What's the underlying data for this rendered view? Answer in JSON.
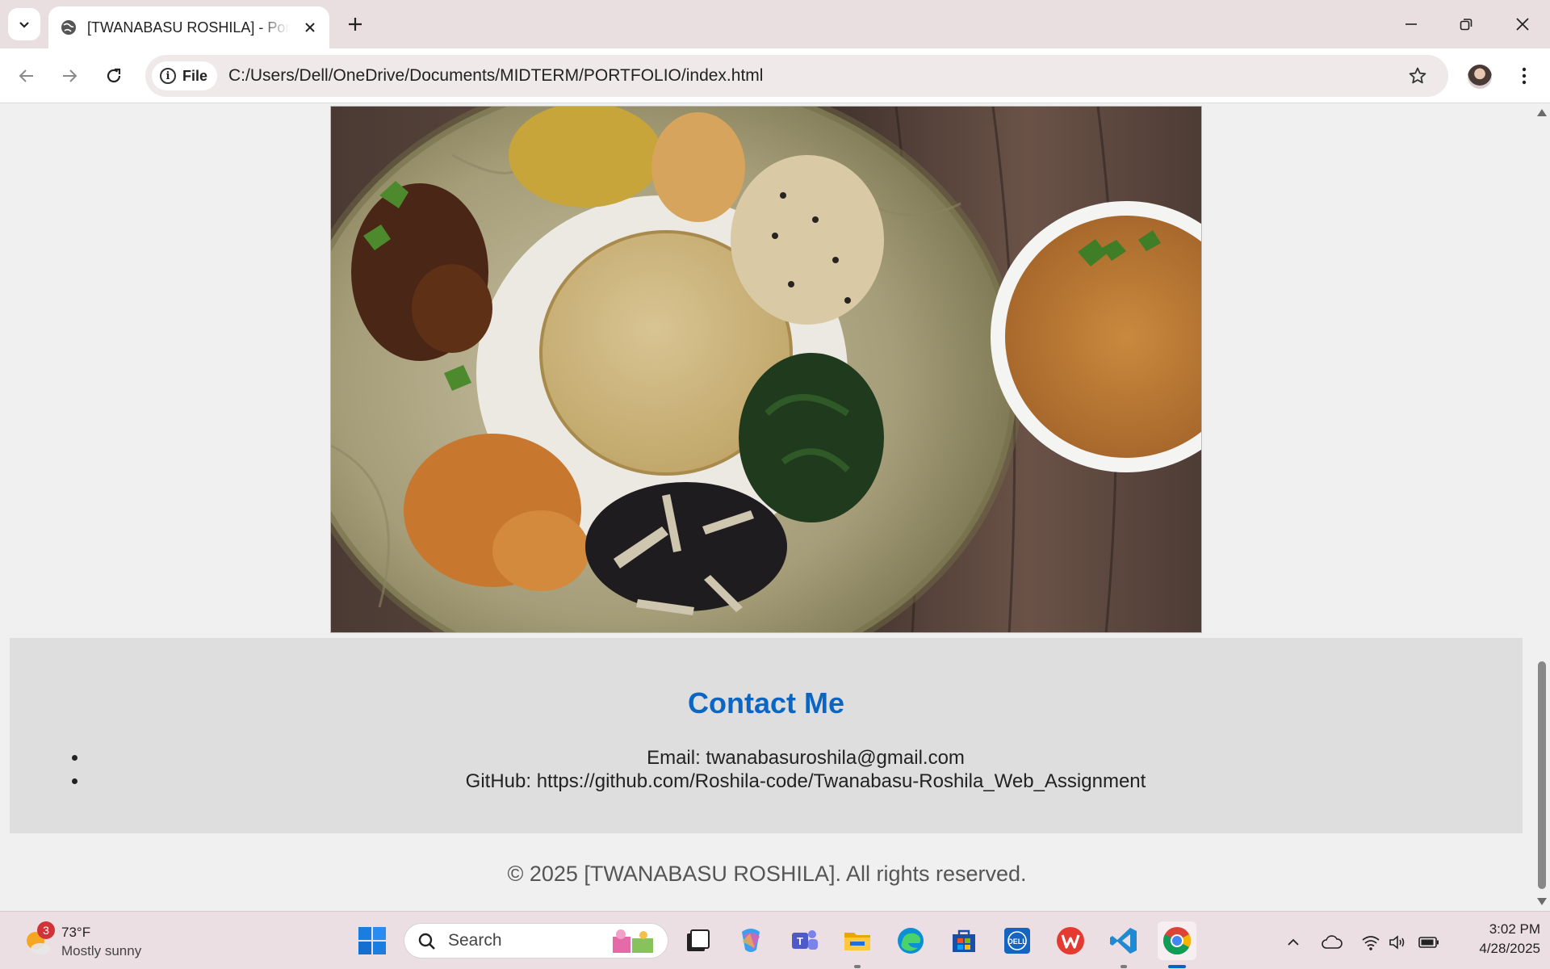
{
  "browser": {
    "tab_title": "[TWANABASU ROSHILA] - Portfolio",
    "site_chip_label": "File",
    "url": "C:/Users/Dell/OneDrive/Documents/MIDTERM/PORTFOLIO/index.html"
  },
  "page": {
    "food_image_alt": "Nepali thali plate",
    "contact": {
      "title": "Contact Me",
      "items": [
        "Email: twanabasuroshila@gmail.com",
        "GitHub: https://github.com/Roshila-code/Twanabasu-Roshila_Web_Assignment"
      ]
    },
    "footer": "© 2025 [TWANABASU ROSHILA]. All rights reserved."
  },
  "taskbar": {
    "weather_badge": "3",
    "weather_temp": "73°F",
    "weather_desc": "Mostly sunny",
    "search_label": "Search",
    "time": "3:02 PM",
    "date": "4/28/2025"
  },
  "colors": {
    "heading_accent": "#0b66c3",
    "contact_bg": "#dedede",
    "page_bg": "#f0f0f0"
  }
}
